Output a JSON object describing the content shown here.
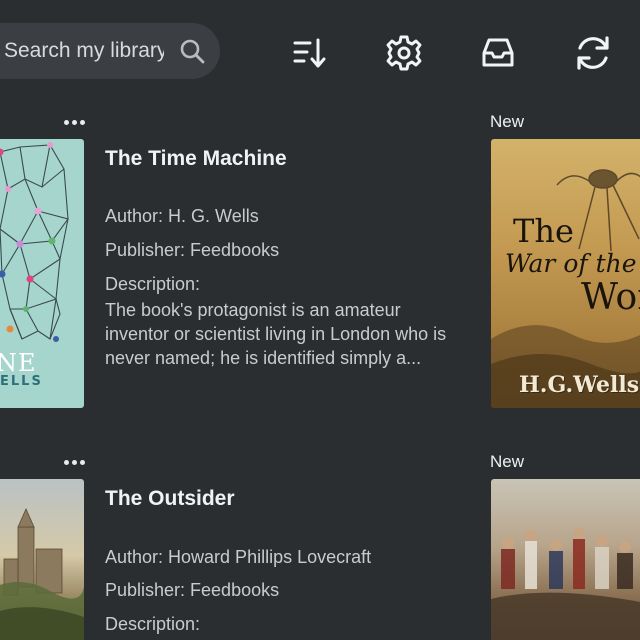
{
  "search": {
    "placeholder": "Search my library",
    "value": ""
  },
  "toolbar": {
    "sort_icon": "sort-descending-icon",
    "settings_icon": "gear-icon",
    "inbox_icon": "inbox-tray-icon",
    "sync_icon": "sync-icon"
  },
  "books": [
    {
      "title": "The Time Machine",
      "author": "Author: H. G. Wells",
      "publisher": "Publisher: Feedbooks",
      "description_label": "Description:",
      "description": "The book's protagonist is an amateur inventor or scientist living in London who is never named; he is identified simply a...",
      "cover_text_line1": "NE",
      "cover_text_line2": "ELLS"
    },
    {
      "title": "The Outsider",
      "author": "Author: Howard Phillips Lovecraft",
      "publisher": "Publisher: Feedbooks",
      "description_label": "Description:"
    }
  ],
  "side_books": [
    {
      "badge": "New",
      "cover_title_1": "The",
      "cover_title_2": "War of the",
      "cover_title_3": "World",
      "cover_author": "H.G.Wells"
    },
    {
      "badge": "New"
    }
  ],
  "colors": {
    "background": "#2b2e31",
    "search_bg": "#3b3f43",
    "text": "#e9eaeb",
    "muted_text": "#c9cbcd",
    "time_machine_cover": "#a6d5cd",
    "war_worlds_cover": "#c9a25a"
  }
}
